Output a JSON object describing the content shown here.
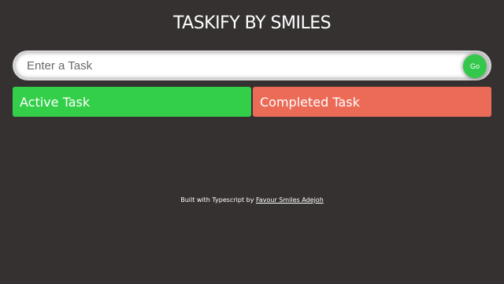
{
  "header": {
    "title": "TASKIFY BY SMILES"
  },
  "task_input": {
    "placeholder": "Enter a Task",
    "value": "",
    "submit_label": "Go"
  },
  "columns": {
    "active_label": "Active Task",
    "completed_label": "Completed Task"
  },
  "footer": {
    "text": "Built with Typescript by",
    "author_link": "Favour Smiles Adejoh"
  },
  "colors": {
    "background": "#353131",
    "active": "#33cf49",
    "completed": "#eb6b57",
    "go_button": "#33c84b"
  }
}
